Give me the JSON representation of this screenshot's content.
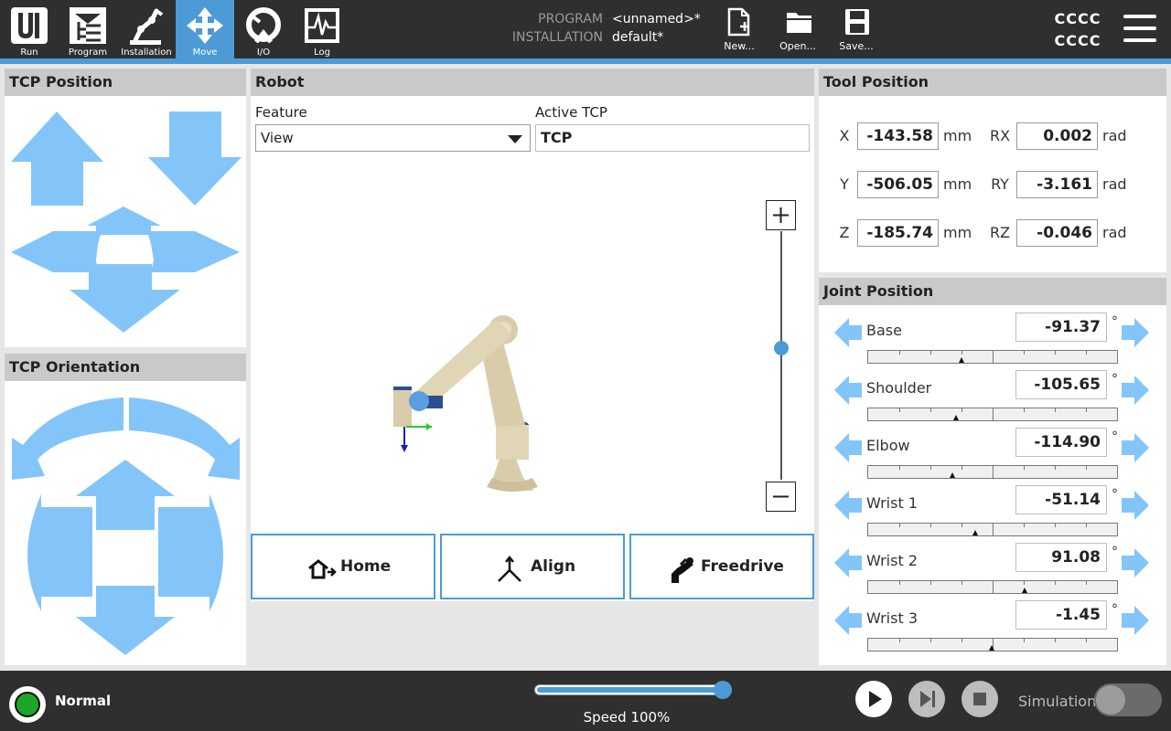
{
  "nav": [
    {
      "label": "Run",
      "icon": "ur-logo-icon"
    },
    {
      "label": "Program",
      "icon": "program-icon"
    },
    {
      "label": "Installation",
      "icon": "installation-icon"
    },
    {
      "label": "Move",
      "icon": "move-icon",
      "active": true
    },
    {
      "label": "I/O",
      "icon": "io-icon"
    },
    {
      "label": "Log",
      "icon": "log-icon"
    }
  ],
  "program_info": {
    "program_key": "PROGRAM",
    "program_value": "<unnamed>*",
    "installation_key": "INSTALLATION",
    "installation_value": "default*"
  },
  "file_actions": [
    {
      "label": "New...",
      "icon": "new-file-icon"
    },
    {
      "label": "Open...",
      "icon": "open-folder-icon"
    },
    {
      "label": "Save...",
      "icon": "save-disk-icon"
    }
  ],
  "robot_name": {
    "line1": "CCCC",
    "line2": "CCCC"
  },
  "tcp_position": {
    "title": "TCP Position"
  },
  "tcp_orientation": {
    "title": "TCP Orientation"
  },
  "robot": {
    "title": "Robot",
    "feature_label": "Feature",
    "feature_value": "View",
    "active_tcp_label": "Active TCP",
    "active_tcp_value": "TCP",
    "actions": [
      {
        "label": "Home",
        "icon": "home-icon"
      },
      {
        "label": "Align",
        "icon": "align-icon"
      },
      {
        "label": "Freedrive",
        "icon": "freedrive-icon"
      }
    ]
  },
  "tool_position": {
    "title": "Tool Position",
    "rows": [
      {
        "axis": "X",
        "value": "-143.58",
        "unit": "mm",
        "rot_axis": "RX",
        "rot_value": "0.002",
        "rot_unit": "rad"
      },
      {
        "axis": "Y",
        "value": "-506.05",
        "unit": "mm",
        "rot_axis": "RY",
        "rot_value": "-3.161",
        "rot_unit": "rad"
      },
      {
        "axis": "Z",
        "value": "-185.74",
        "unit": "mm",
        "rot_axis": "RZ",
        "rot_value": "-0.046",
        "rot_unit": "rad"
      }
    ]
  },
  "joint_position": {
    "title": "Joint Position",
    "unit": "°",
    "joints": [
      {
        "name": "Base",
        "value": "-91.37",
        "level": 0.374
      },
      {
        "name": "Shoulder",
        "value": "-105.65",
        "level": 0.353
      },
      {
        "name": "Elbow",
        "value": "-114.90",
        "level": 0.34
      },
      {
        "name": "Wrist 1",
        "value": "-51.14",
        "level": 0.429
      },
      {
        "name": "Wrist 2",
        "value": "91.08",
        "level": 0.627
      },
      {
        "name": "Wrist 3",
        "value": "-1.45",
        "level": 0.498
      }
    ]
  },
  "status": {
    "label": "Normal",
    "color": "#1fa626"
  },
  "speed": {
    "label": "Speed 100%",
    "percent": 100
  },
  "simulation": {
    "label": "Simulation",
    "on": false
  },
  "colors": {
    "accent": "#4c9bd6",
    "arrow": "#84c5f9",
    "topbar": "#2f2f2f"
  }
}
